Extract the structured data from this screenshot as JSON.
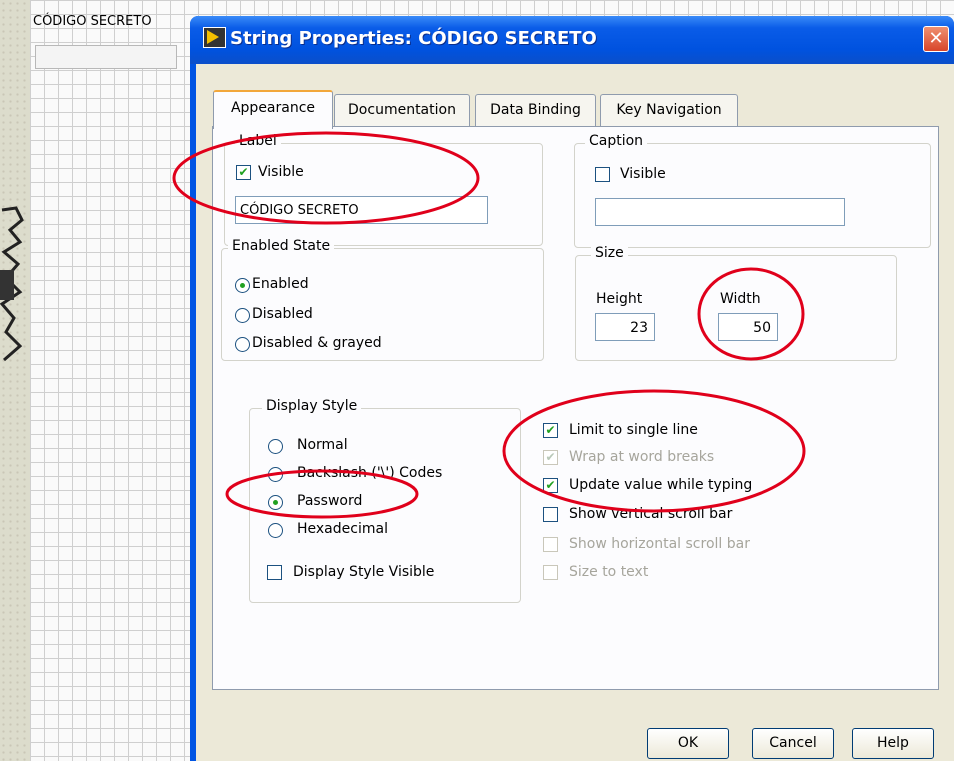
{
  "background": {
    "control_label": "CÓDIGO SECRETO"
  },
  "dialog": {
    "title": "String Properties: CÓDIGO SECRETO",
    "close_glyph": "✕",
    "tabs": [
      {
        "label": "Appearance",
        "active": true
      },
      {
        "label": "Documentation",
        "active": false
      },
      {
        "label": "Data Binding",
        "active": false
      },
      {
        "label": "Key Navigation",
        "active": false
      }
    ],
    "label_group": {
      "title": "Label",
      "visible_label": "Visible",
      "visible_checked": true,
      "text_value": "CÓDIGO SECRETO"
    },
    "caption_group": {
      "title": "Caption",
      "visible_label": "Visible",
      "visible_checked": false,
      "text_value": ""
    },
    "enabled_state": {
      "title": "Enabled State",
      "options": [
        "Enabled",
        "Disabled",
        "Disabled & grayed"
      ],
      "selected": "Enabled"
    },
    "size": {
      "title": "Size",
      "height_label": "Height",
      "height_value": "23",
      "width_label": "Width",
      "width_value": "50"
    },
    "display_style": {
      "title": "Display Style",
      "options": [
        "Normal",
        "Backslash ('\\') Codes",
        "Password",
        "Hexadecimal"
      ],
      "selected": "Password",
      "visible_checkbox_label": "Display Style Visible",
      "visible_checked": false
    },
    "options": [
      {
        "label": "Limit to single line",
        "checked": true,
        "enabled": true
      },
      {
        "label": "Wrap at word breaks",
        "checked": true,
        "enabled": false
      },
      {
        "label": "Update value while typing",
        "checked": true,
        "enabled": true
      },
      {
        "label": "Show vertical scroll bar",
        "checked": false,
        "enabled": true
      },
      {
        "label": "Show horizontal scroll bar",
        "checked": false,
        "enabled": false
      },
      {
        "label": "Size to text",
        "checked": false,
        "enabled": false
      }
    ],
    "buttons": {
      "ok": "OK",
      "cancel": "Cancel",
      "help": "Help"
    }
  },
  "colors": {
    "titlebar": "#0054e3",
    "annotation_ellipse": "#e0001b",
    "check_mark": "#21a121"
  },
  "icons": {
    "app_icon": "labview-vi-icon",
    "close": "close-icon",
    "check": "check-icon"
  }
}
